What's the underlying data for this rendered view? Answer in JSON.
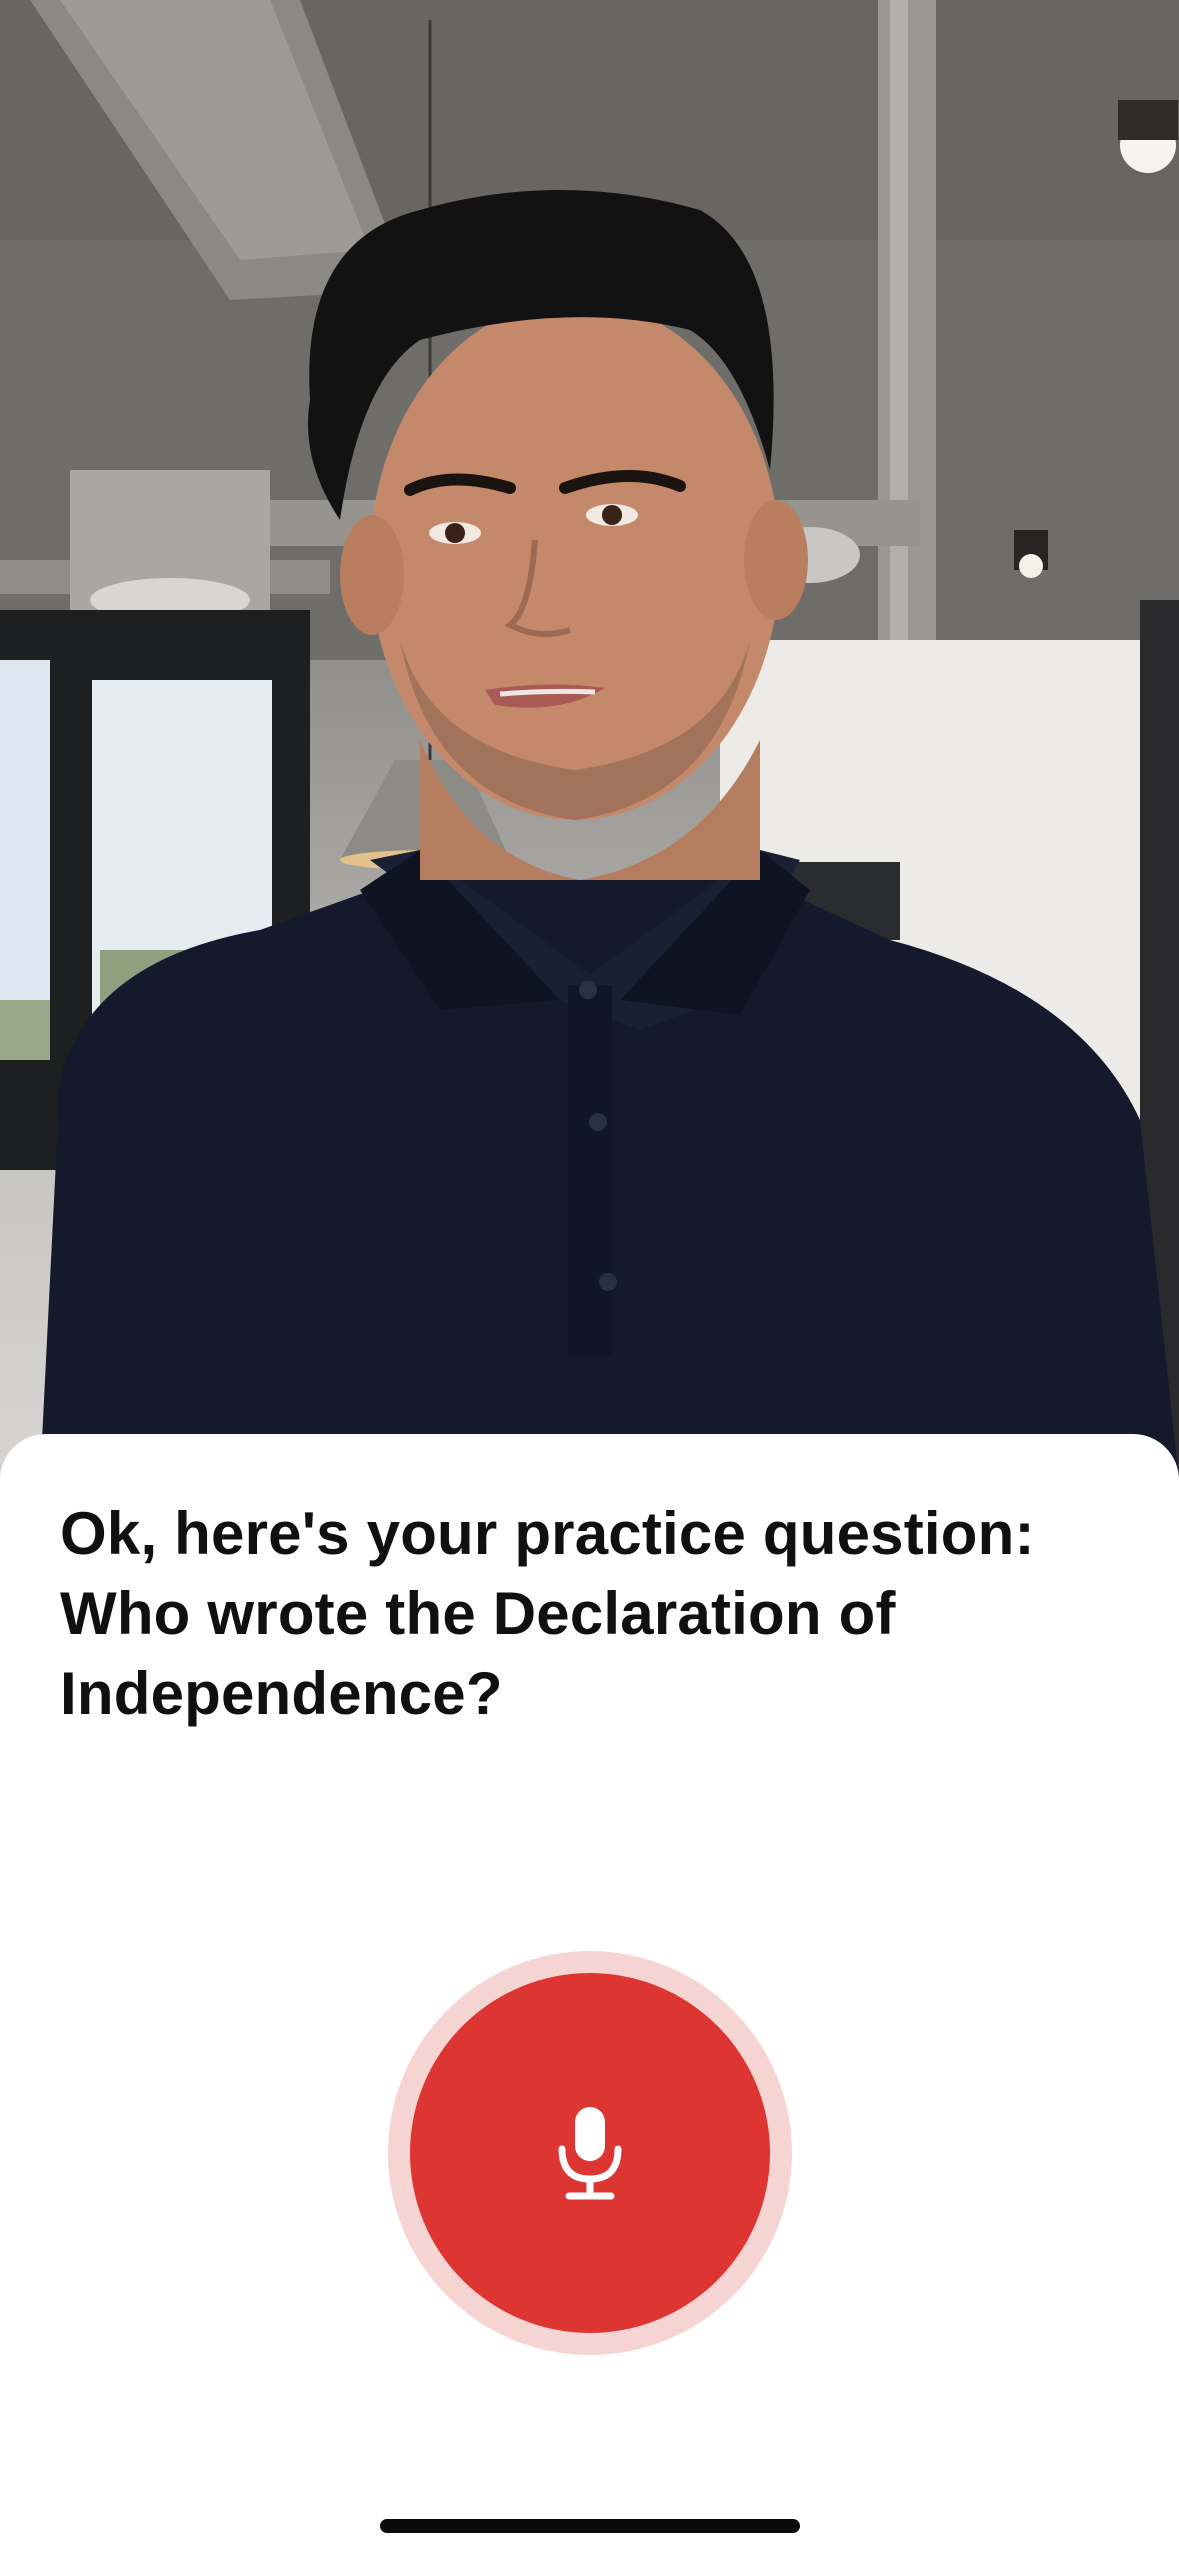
{
  "conversation": {
    "prompt": "Ok, here's your practice question: Who wrote the Declaration of Independence?"
  },
  "icons": {
    "mic_button": "microphone-icon"
  },
  "colors": {
    "mic_button": "#dd3531",
    "mic_halo": "#f6d4d2",
    "text": "#101010",
    "sheet": "#ffffff",
    "home_indicator": "#0a0a0a"
  }
}
